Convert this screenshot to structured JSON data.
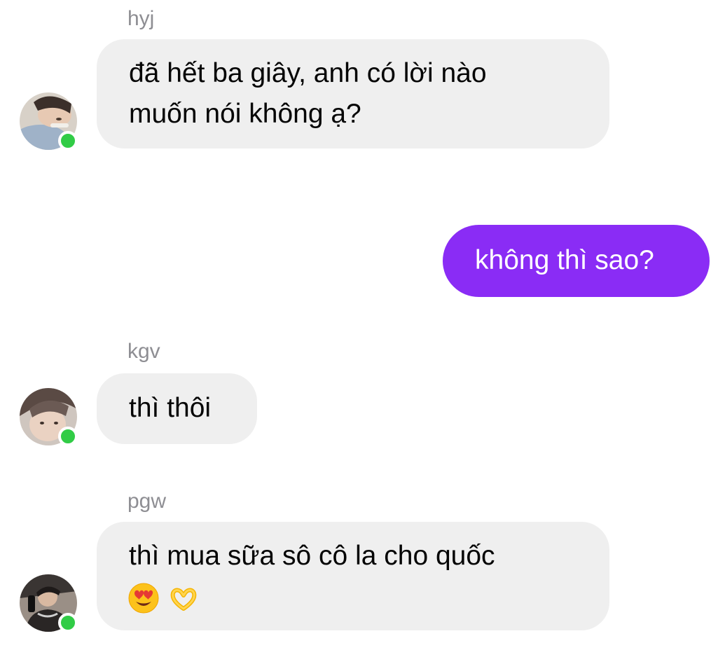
{
  "messages": [
    {
      "sender": "hyj",
      "lines": [
        "đã hết ba giây, anh có lời nào",
        "muốn nói không ạ?"
      ],
      "avatar_icon": "user-avatar-photo",
      "status": "online"
    },
    {
      "sender": "",
      "lines": [
        "không thì sao?"
      ],
      "outgoing": true
    },
    {
      "sender": "kgv",
      "lines": [
        "thì thôi"
      ],
      "avatar_icon": "user-avatar-photo",
      "status": "online"
    },
    {
      "sender": "pgw",
      "lines": [
        "thì mua sữa sô cô la cho quốc"
      ],
      "emojis": [
        "heart-eyes-emoji",
        "heart-hands-emoji"
      ],
      "avatar_icon": "user-avatar-photo",
      "status": "online"
    }
  ],
  "colors": {
    "outgoing_bubble": "#8a2cf5",
    "incoming_bubble": "#efefef",
    "online_dot": "#31cc46",
    "sender_name": "#8e8e93"
  }
}
